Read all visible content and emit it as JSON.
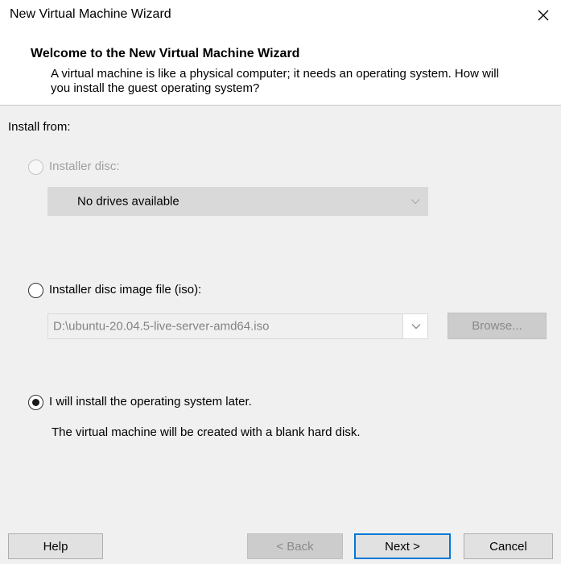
{
  "window": {
    "title": "New Virtual Machine Wizard"
  },
  "header": {
    "heading": "Welcome to the New Virtual Machine Wizard",
    "description": "A virtual machine is like a physical computer; it needs an operating system. How will you install the guest operating system?"
  },
  "install": {
    "section_label": "Install from:",
    "options": [
      {
        "label": "Installer disc:",
        "selected": false,
        "enabled": false
      },
      {
        "label": "Installer disc image file (iso):",
        "selected": false,
        "enabled": true
      },
      {
        "label": "I will install the operating system later.",
        "selected": true,
        "enabled": true
      }
    ],
    "disc_drive": {
      "value": "No drives available"
    },
    "iso": {
      "value": "D:\\ubuntu-20.04.5-live-server-amd64.iso",
      "browse_label": "Browse..."
    },
    "later_note": "The virtual machine will be created with a blank hard disk."
  },
  "footer": {
    "help_label": "Help",
    "back_label": "< Back",
    "next_label": "Next >",
    "cancel_label": "Cancel"
  },
  "colors": {
    "accent": "#0078d7",
    "panel_background": "#f0f0f0",
    "disabled_text": "#a0a0a0"
  },
  "icons": {
    "close": "close-icon",
    "dropdown": "chevron-down-icon"
  }
}
